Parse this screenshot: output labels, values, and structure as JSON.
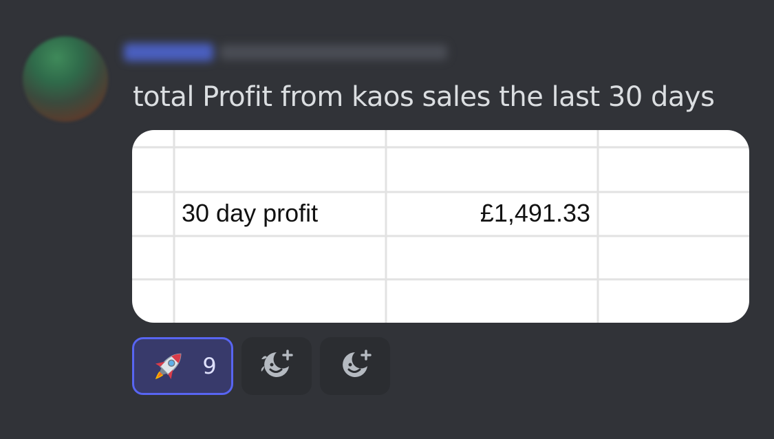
{
  "message": {
    "text": "total Profit from kaos sales the last 30 days"
  },
  "attachment": {
    "row_label": "30 day profit",
    "row_value": "£1,491.33"
  },
  "reactions": [
    {
      "icon": "rocket-icon",
      "count": "9",
      "active": true
    },
    {
      "icon": "add-super-reaction-icon"
    },
    {
      "icon": "add-reaction-icon"
    }
  ],
  "colors": {
    "background": "#313338",
    "text": "#dbdee1",
    "active_reaction_border": "#5865f2",
    "active_reaction_bg": "#383a6b",
    "reaction_bg": "#2b2d31",
    "icon": "#b5bac1"
  }
}
